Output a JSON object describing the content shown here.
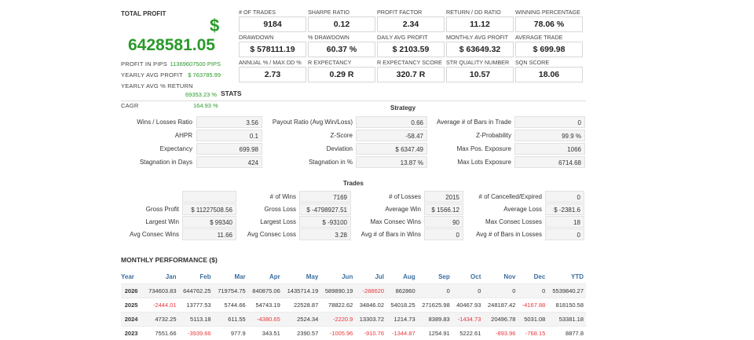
{
  "summary": {
    "total_profit_label": "TOTAL PROFIT",
    "currency_symbol": "$",
    "total_profit_value": "6428581.05",
    "rows": [
      {
        "label": "PROFIT IN PIPS",
        "value": "11369607500 PIPS"
      },
      {
        "label": "YEARLY AVG PROFIT",
        "value": "$ 763785.99"
      },
      {
        "label": "YEARLY AVG % RETURN",
        "value": "69353.23 %"
      },
      {
        "label": "CAGR",
        "value": "164.93 %"
      }
    ]
  },
  "metrics": [
    {
      "label": "# OF TRADES",
      "value": "9184"
    },
    {
      "label": "SHARPE RATIO",
      "value": "0.12"
    },
    {
      "label": "PROFIT FACTOR",
      "value": "2.34"
    },
    {
      "label": "RETURN / DD RATIO",
      "value": "11.12"
    },
    {
      "label": "WINNING PERCENTAGE",
      "value": "78.06 %"
    },
    {
      "label": "DRAWDOWN",
      "value": "$ 578111.19"
    },
    {
      "label": "% DRAWDOWN",
      "value": "60.37 %"
    },
    {
      "label": "DAILY AVG PROFIT",
      "value": "$ 2103.59"
    },
    {
      "label": "MONTHLY AVG PROFIT",
      "value": "$ 63649.32"
    },
    {
      "label": "AVERAGE TRADE",
      "value": "$ 699.98"
    },
    {
      "label": "ANNUAL % / MAX DD %",
      "value": "2.73"
    },
    {
      "label": "R EXPECTANCY",
      "value": "0.29 R"
    },
    {
      "label": "R EXPECTANCY SCORE",
      "value": "320.7 R"
    },
    {
      "label": "STR QUALITY NUMBER",
      "value": "10.57"
    },
    {
      "label": "SQN SCORE",
      "value": "18.06"
    }
  ],
  "stats": {
    "title": "STATS",
    "strategy_title": "Strategy",
    "strategy_rows": [
      [
        {
          "label": "Wins / Losses Ratio",
          "value": "3.56"
        },
        {
          "label": "Payout Ratio (Avg Win/Loss)",
          "value": "0.66"
        },
        {
          "label": "Average # of Bars in Trade",
          "value": "0"
        }
      ],
      [
        {
          "label": "AHPR",
          "value": "0.1"
        },
        {
          "label": "Z-Score",
          "value": "-58.47"
        },
        {
          "label": "Z-Probability",
          "value": "99.9 %"
        }
      ],
      [
        {
          "label": "Expectancy",
          "value": "699.98"
        },
        {
          "label": "Deviation",
          "value": "$ 6347.49"
        },
        {
          "label": "Max Pos. Exposure",
          "value": "1066"
        }
      ],
      [
        {
          "label": "Stagnation in Days",
          "value": "424"
        },
        {
          "label": "Stagnation in %",
          "value": "13.87 %"
        },
        {
          "label": "Max Lots Exposure",
          "value": "6714.68"
        }
      ]
    ],
    "trades_title": "Trades",
    "trades_rows": [
      [
        {
          "label": "",
          "value": ""
        },
        {
          "label": "# of Wins",
          "value": "7169"
        },
        {
          "label": "# of Losses",
          "value": "2015"
        },
        {
          "label": "# of Cancelled/Expired",
          "value": "0"
        }
      ],
      [
        {
          "label": "Gross Profit",
          "value": "$ 11227508.56"
        },
        {
          "label": "Gross Loss",
          "value": "$ -4798927.51"
        },
        {
          "label": "Average Win",
          "value": "$ 1566.12"
        },
        {
          "label": "Average Loss",
          "value": "$ -2381.6"
        }
      ],
      [
        {
          "label": "Largest Win",
          "value": "$ 99340"
        },
        {
          "label": "Largest Loss",
          "value": "$ -93100"
        },
        {
          "label": "Max Consec Wins",
          "value": "90"
        },
        {
          "label": "Max Consec Losses",
          "value": "18"
        }
      ],
      [
        {
          "label": "Avg Consec Wins",
          "value": "11.66"
        },
        {
          "label": "Avg Consec Loss",
          "value": "3.28"
        },
        {
          "label": "Avg # of Bars in Wins",
          "value": "0"
        },
        {
          "label": "Avg # of Bars in Losses",
          "value": "0"
        }
      ]
    ]
  },
  "monthly": {
    "title": "MONTHLY PERFORMANCE ($)",
    "headers": [
      "Year",
      "Jan",
      "Feb",
      "Mar",
      "Apr",
      "May",
      "Jun",
      "Jul",
      "Aug",
      "Sep",
      "Oct",
      "Nov",
      "Dec",
      "YTD"
    ],
    "rows": [
      [
        "2026",
        "734603.83",
        "644762.25",
        "719754.75",
        "840875.06",
        "1435714.19",
        "589890.19",
        "-288620",
        "862860",
        "0",
        "0",
        "0",
        "0",
        "5539840.27"
      ],
      [
        "2025",
        "-2444.01",
        "13777.53",
        "5744.66",
        "54743.19",
        "22528.87",
        "78822.62",
        "34846.02",
        "54018.25",
        "271625.98",
        "40467.93",
        "248187.42",
        "-4167.88",
        "818150.58"
      ],
      [
        "2024",
        "4732.25",
        "5113.18",
        "611.55",
        "-4380.65",
        "2524.34",
        "-2220.9",
        "13303.72",
        "1214.73",
        "8389.83",
        "-1434.73",
        "20496.78",
        "5031.08",
        "53381.18"
      ],
      [
        "2023",
        "7551.66",
        "-3939.66",
        "977.9",
        "343.51",
        "2390.57",
        "-1005.96",
        "-910.76",
        "-1344.87",
        "1254.91",
        "5222.61",
        "-893.96",
        "-768.15",
        "8877.8"
      ]
    ]
  },
  "colors": {
    "profit_green": "#2a9a2a",
    "negative_red": "#e8373c",
    "header_blue": "#3b6e9f"
  }
}
